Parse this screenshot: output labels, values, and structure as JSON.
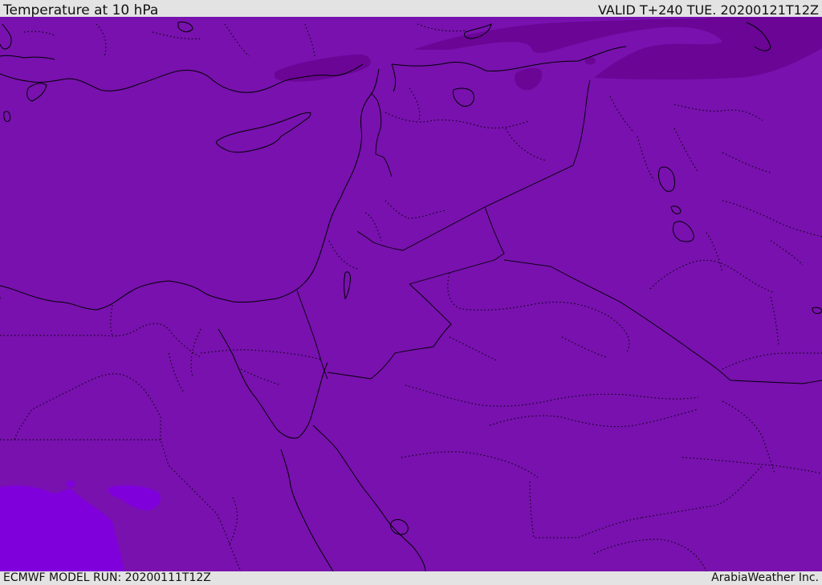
{
  "header": {
    "title": "Temperature at 10 hPa",
    "valid": "VALID T+240 TUE. 20200121T12Z"
  },
  "footer": {
    "model_run": "ECMWF MODEL RUN: 20200111T12Z",
    "credit": "ArabiaWeather Inc."
  },
  "map": {
    "fill_colors": {
      "base": "#7811ae",
      "cold": "#6a0596",
      "warm": "#8000dc"
    },
    "coastline_color": "#000000",
    "border_style": "dotted"
  }
}
